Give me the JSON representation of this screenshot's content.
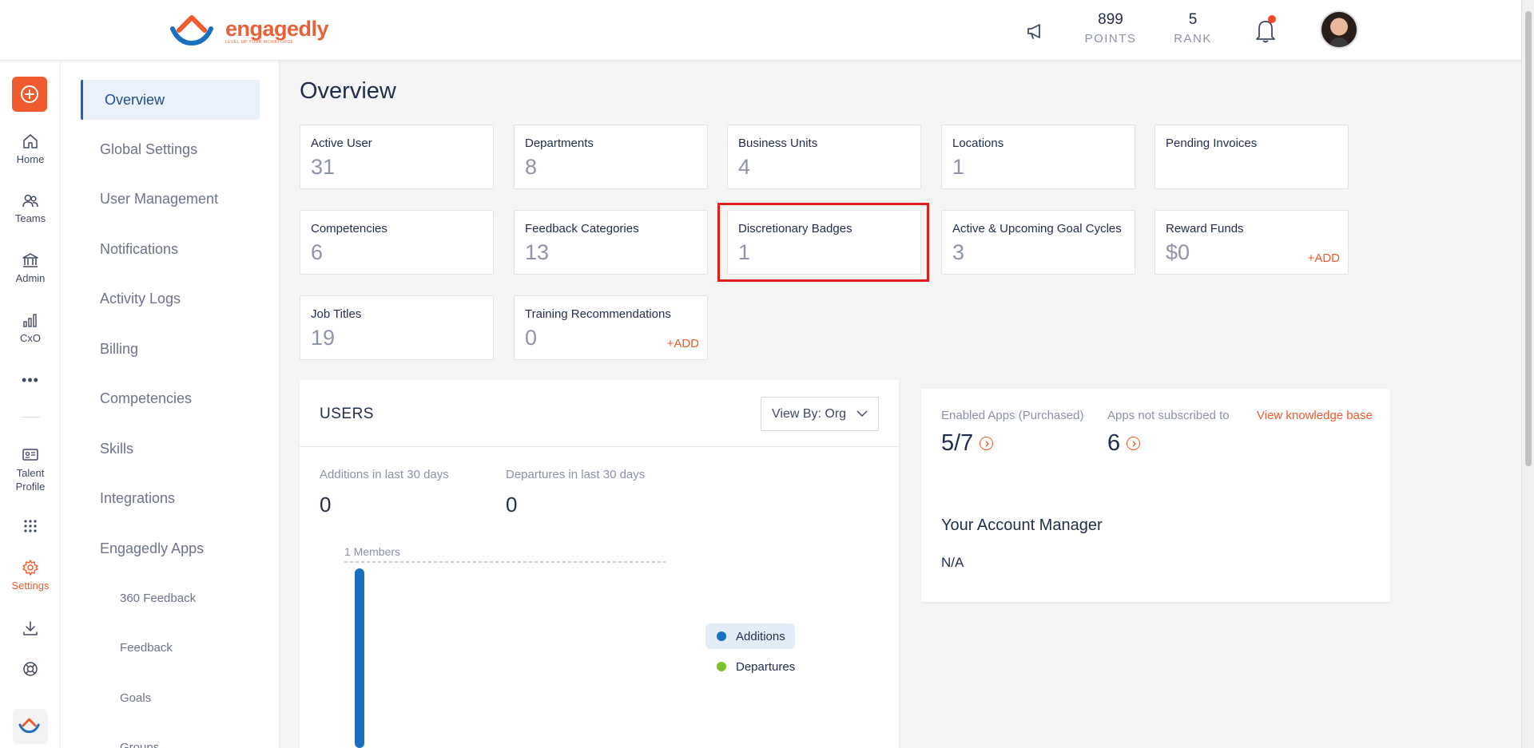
{
  "header": {
    "brand": "engagedly",
    "tagline": "LEVEL UP YOUR WORKFORCE",
    "points_value": "899",
    "points_label": "POINTS",
    "rank_value": "5",
    "rank_label": "RANK"
  },
  "rail": {
    "items": [
      {
        "label": "Home",
        "icon": "home-icon"
      },
      {
        "label": "Teams",
        "icon": "teams-icon"
      },
      {
        "label": "Admin",
        "icon": "admin-icon"
      },
      {
        "label": "CxO",
        "icon": "chart-bars-icon"
      },
      {
        "label": "Talent Profile",
        "icon": "id-card-icon"
      },
      {
        "label": "Settings",
        "icon": "gear-icon"
      }
    ],
    "accent_color": "#ef5b2c"
  },
  "subnav": {
    "items": [
      "Overview",
      "Global Settings",
      "User Management",
      "Notifications",
      "Activity Logs",
      "Billing",
      "Competencies",
      "Skills",
      "Integrations",
      "Engagedly Apps"
    ],
    "subitems": [
      "360 Feedback",
      "Feedback",
      "Goals",
      "Groups"
    ],
    "active": "Overview"
  },
  "page": {
    "title": "Overview"
  },
  "cards": [
    {
      "label": "Active User",
      "value": "31"
    },
    {
      "label": "Departments",
      "value": "8"
    },
    {
      "label": "Business Units",
      "value": "4"
    },
    {
      "label": "Locations",
      "value": "1"
    },
    {
      "label": "Pending Invoices",
      "value": ""
    },
    {
      "label": "Competencies",
      "value": "6"
    },
    {
      "label": "Feedback Categories",
      "value": "13"
    },
    {
      "label": "Discretionary Badges",
      "value": "1"
    },
    {
      "label": "Active & Upcoming Goal Cycles",
      "value": "3"
    },
    {
      "label": "Reward Funds",
      "value": "$0",
      "action": "+ADD"
    },
    {
      "label": "Job Titles",
      "value": "19"
    },
    {
      "label": "Training Recommendations",
      "value": "0",
      "action": "+ADD"
    }
  ],
  "users": {
    "title": "USERS",
    "view_by": "View By: Org",
    "additions_label": "Additions in last 30 days",
    "additions_value": "0",
    "departures_label": "Departures in last 30 days",
    "departures_value": "0",
    "chart_line_label": "1 Members",
    "legend": [
      {
        "label": "Additions",
        "color": "#1a6fc0"
      },
      {
        "label": "Departures",
        "color": "#7cc22a"
      }
    ]
  },
  "apps": {
    "enabled_label": "Enabled Apps (Purchased)",
    "enabled_value": "5/7",
    "not_subscribed_label": "Apps not subscribed to",
    "not_subscribed_value": "6",
    "kb_link": "View knowledge base",
    "account_manager_title": "Your Account Manager",
    "account_manager_value": "N/A"
  }
}
